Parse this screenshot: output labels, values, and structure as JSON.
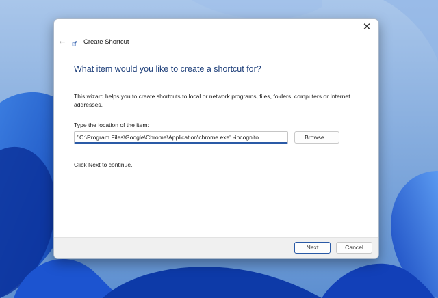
{
  "dialog": {
    "title": "Create Shortcut",
    "heading": "What item would you like to create a shortcut for?",
    "description": "This wizard helps you to create shortcuts to local or network programs, files, folders, computers or Internet addresses.",
    "location_label": "Type the location of the item:",
    "location_value": "\"C:\\Program Files\\Google\\Chrome\\Application\\chrome.exe\" -incognito",
    "browse_label": "Browse...",
    "continue_text": "Click Next to continue.",
    "next_label": "Next",
    "cancel_label": "Cancel",
    "close_glyph": "✕",
    "back_glyph": "←"
  },
  "icons": {
    "close": "close-icon",
    "back": "back-arrow-icon",
    "app": "shortcut-wizard-icon"
  },
  "colors": {
    "heading": "#1e3f7a",
    "accent": "#2a5aa6",
    "footer": "#f0f0f0",
    "wallpaper": "#6f9fd8"
  }
}
